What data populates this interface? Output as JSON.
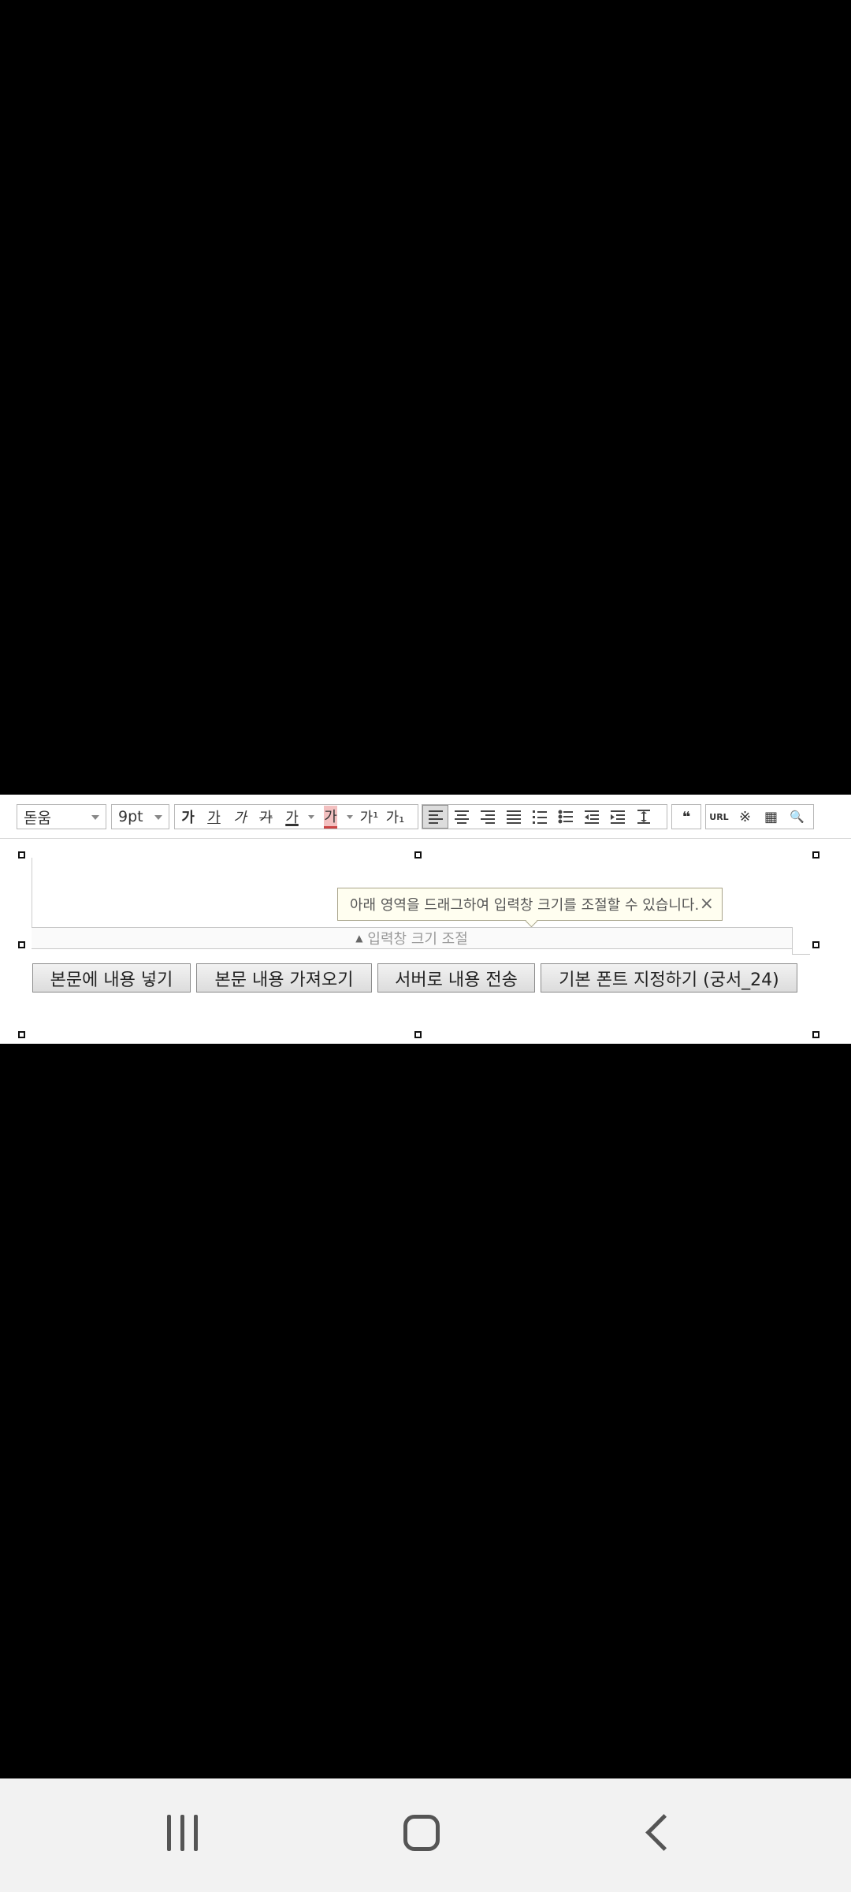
{
  "toolbar": {
    "font_family": "돋움",
    "font_size": "9pt",
    "style_buttons": [
      "가",
      "가",
      "가",
      "가",
      "가"
    ],
    "bg_color_label": "가",
    "superscript_label": "가¹",
    "subscript_label": "가₁",
    "quote_label": "❝",
    "url_label": "URL",
    "special_char_label": "※",
    "table_label": "▦",
    "find_label": "🔍"
  },
  "tooltip": {
    "text": "아래 영역을 드래그하여 입력창 크기를 조절할 수 있습니다.",
    "close": "×"
  },
  "resize_bar": {
    "label": "입력창 크기 조절"
  },
  "actions": {
    "insert": "본문에 내용 넣기",
    "import": "본문 내용 가져오기",
    "send": "서버로 내용 전송",
    "default_font": "기본 폰트 지정하기 (궁서_24)"
  },
  "navbar": {
    "recents": "recents-icon",
    "home": "home-icon",
    "back": "back-icon"
  }
}
